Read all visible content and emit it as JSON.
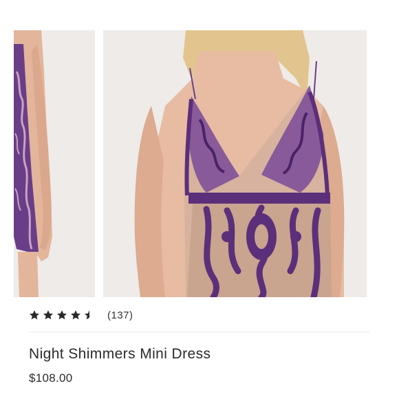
{
  "gallery": {
    "images": [
      {
        "icon": "dress-photo-side-view"
      },
      {
        "icon": "dress-photo-front-closeup"
      }
    ]
  },
  "product": {
    "rating": 4.5,
    "rating_max": 5,
    "review_count": "(137)",
    "name": "Night Shimmers Mini Dress",
    "price": "$108.00"
  },
  "colors": {
    "dress_purple": "#6a3d88",
    "skin": "#e6b9a0",
    "background": "#eeebe8",
    "star": "#2a2a2a"
  }
}
